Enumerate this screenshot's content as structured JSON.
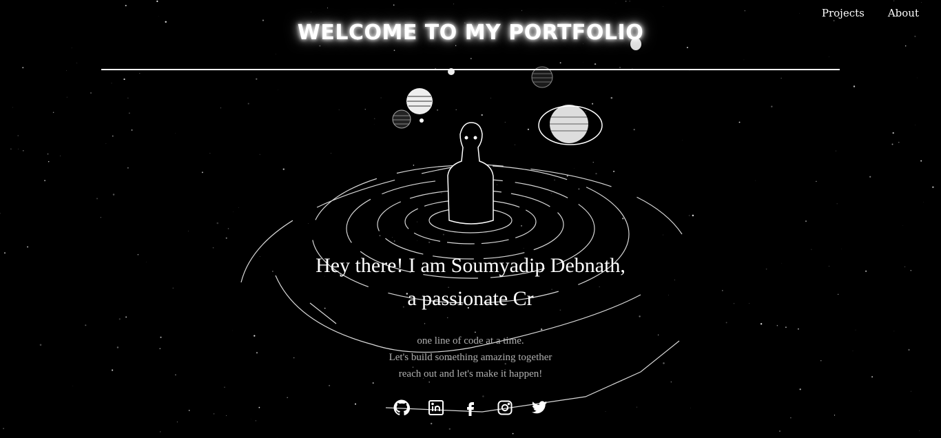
{
  "nav": {
    "items": [
      {
        "label": "Projects"
      },
      {
        "label": "About"
      }
    ]
  },
  "header": {
    "title": "WELCOME TO MY PORTFOLIO"
  },
  "hero": {
    "line1": "Hey there! I am Soumyadip Debnath,",
    "line2": "a passionate Cr"
  },
  "tagline": {
    "lines": [
      "one line of code at a time.",
      "Let's build something amazing together",
      "reach out and let's make it happen!"
    ]
  },
  "socials": [
    {
      "icon": "github-icon"
    },
    {
      "icon": "linkedin-icon"
    },
    {
      "icon": "facebook-icon"
    },
    {
      "icon": "instagram-icon"
    },
    {
      "icon": "twitter-icon"
    }
  ],
  "colors": {
    "background": "#000000",
    "text": "#ffffff",
    "muted_text": "#b0b0b0"
  }
}
